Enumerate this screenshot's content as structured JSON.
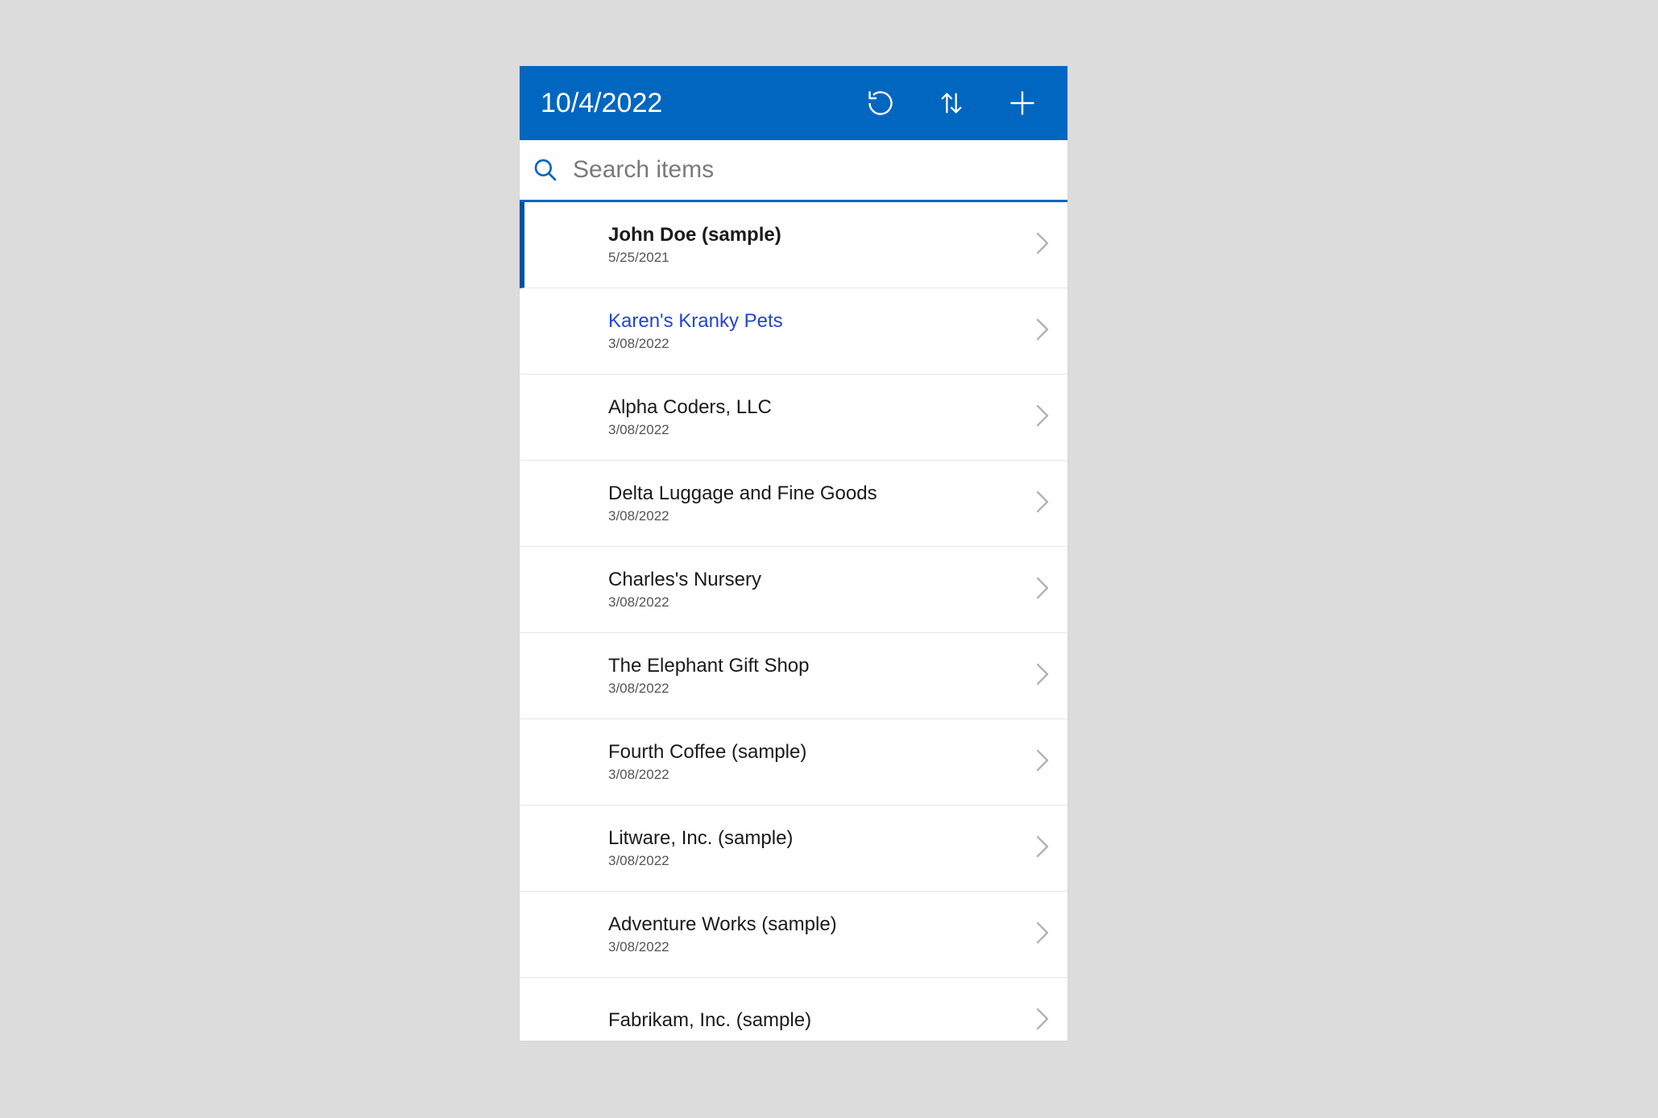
{
  "header": {
    "title": "10/4/2022"
  },
  "search": {
    "placeholder": "Search items",
    "value": ""
  },
  "items": [
    {
      "title": "John Doe (sample)",
      "date": "5/25/2021",
      "selected": true,
      "highlight": false
    },
    {
      "title": "Karen's Kranky Pets",
      "date": "3/08/2022",
      "selected": false,
      "highlight": true
    },
    {
      "title": "Alpha Coders, LLC",
      "date": "3/08/2022",
      "selected": false,
      "highlight": false
    },
    {
      "title": "Delta Luggage and Fine Goods",
      "date": "3/08/2022",
      "selected": false,
      "highlight": false
    },
    {
      "title": "Charles's Nursery",
      "date": "3/08/2022",
      "selected": false,
      "highlight": false
    },
    {
      "title": "The Elephant Gift Shop",
      "date": "3/08/2022",
      "selected": false,
      "highlight": false
    },
    {
      "title": "Fourth Coffee (sample)",
      "date": "3/08/2022",
      "selected": false,
      "highlight": false
    },
    {
      "title": "Litware, Inc. (sample)",
      "date": "3/08/2022",
      "selected": false,
      "highlight": false
    },
    {
      "title": "Adventure Works (sample)",
      "date": "3/08/2022",
      "selected": false,
      "highlight": false
    },
    {
      "title": "Fabrikam, Inc. (sample)",
      "date": "",
      "selected": false,
      "highlight": false
    }
  ]
}
